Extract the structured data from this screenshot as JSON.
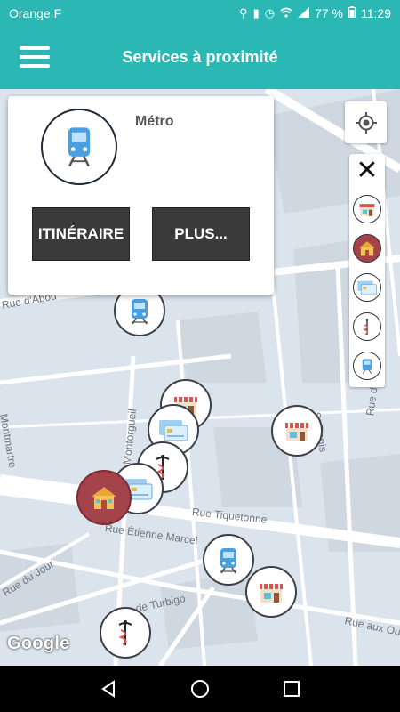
{
  "status_bar": {
    "carrier": "Orange F",
    "battery": "77 %",
    "time": "11:29",
    "icons": [
      "location-icon",
      "vibrate-icon",
      "alarm-icon",
      "wifi-icon",
      "signal-icon",
      "battery-icon"
    ]
  },
  "header": {
    "title": "Services à proximité",
    "menu_icon": "hamburger-menu-icon"
  },
  "info_card": {
    "category": "Métro",
    "icon": "metro-train-icon",
    "itinerary_button": "ITINÉRAIRE",
    "more_button": "PLUS..."
  },
  "map": {
    "streets": [
      "Rue Montorgueil",
      "St Denis",
      "Rue de Palestro",
      "Montmartre",
      "Rue Tiquetonne",
      "Rue Étienne Marcel",
      "Rue du Jour",
      "Rue de Turbigo",
      "Rue aux Our",
      "Rue d'Abou"
    ],
    "attribution": "Google",
    "markers": [
      {
        "type": "metro"
      },
      {
        "type": "shop"
      },
      {
        "type": "shop"
      },
      {
        "type": "bank-card"
      },
      {
        "type": "pharmacy"
      },
      {
        "type": "bank-card"
      },
      {
        "type": "home"
      },
      {
        "type": "metro"
      },
      {
        "type": "shop"
      },
      {
        "type": "pharmacy"
      }
    ]
  },
  "filters": {
    "close_icon": "close-icon",
    "items": [
      {
        "name": "shop",
        "active": false
      },
      {
        "name": "home",
        "active": true
      },
      {
        "name": "bank-card",
        "active": false
      },
      {
        "name": "pharmacy",
        "active": false
      },
      {
        "name": "metro",
        "active": false
      }
    ]
  },
  "nav_bar": {
    "back": "back-icon",
    "home": "home-icon",
    "recents": "recents-icon"
  },
  "colors": {
    "primary": "#2bb8b5",
    "active_filter": "#a5434b",
    "button": "#3a3a3a"
  }
}
